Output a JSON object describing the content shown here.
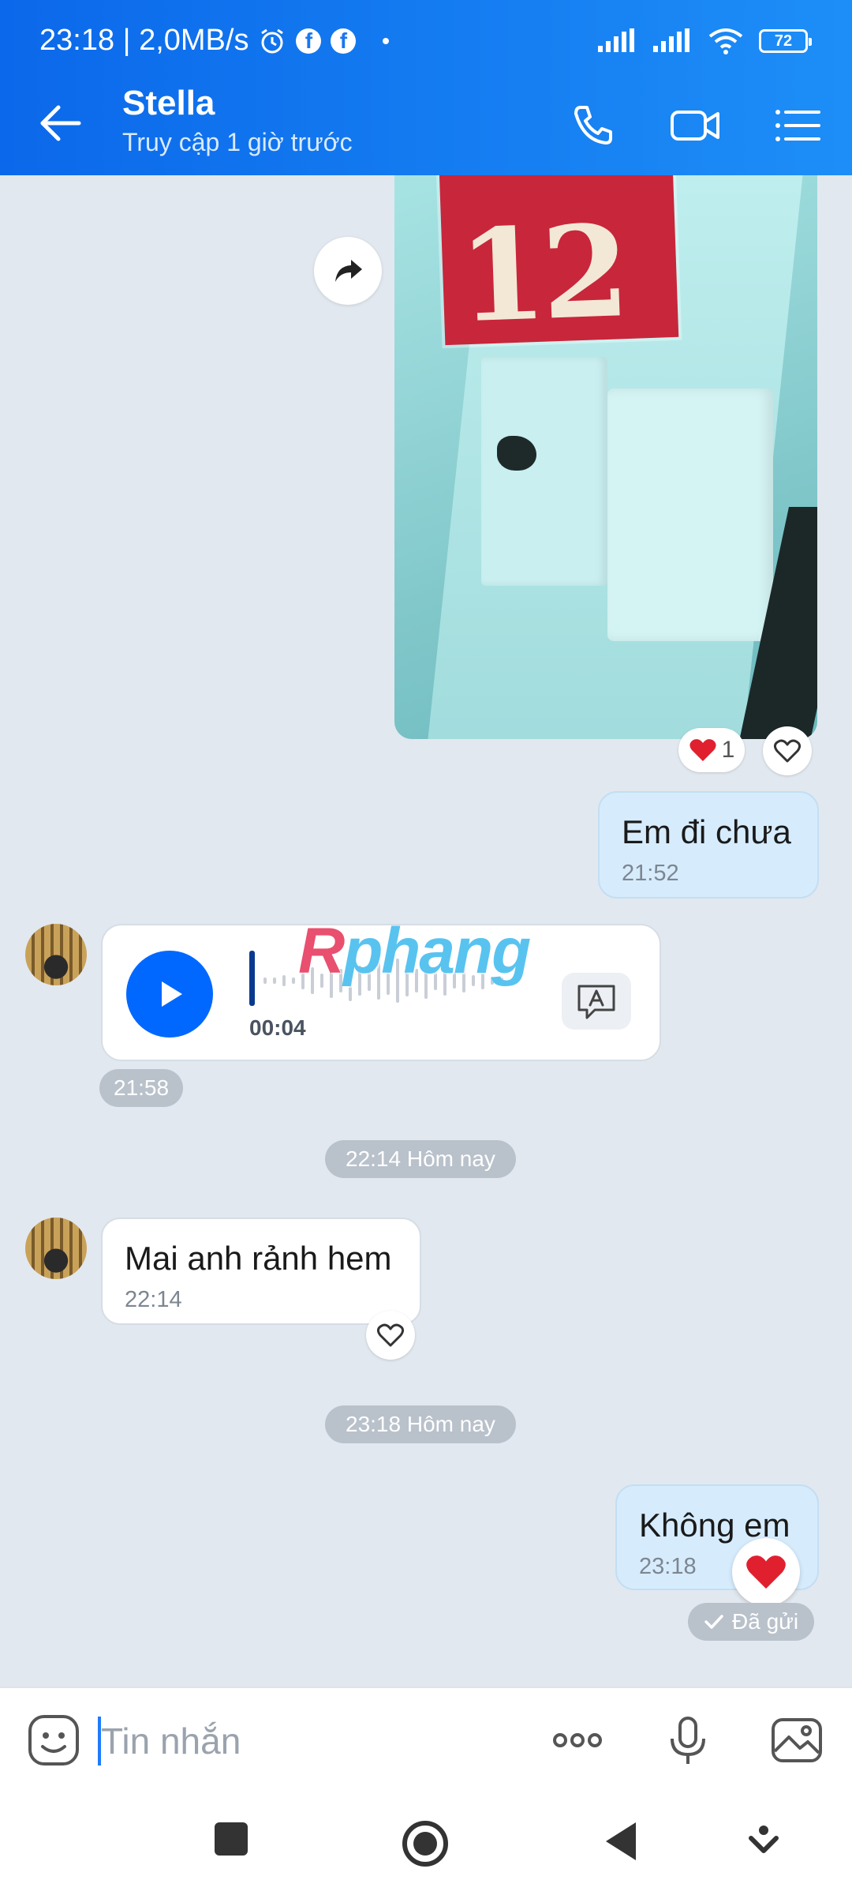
{
  "status_bar": {
    "time_speed": "23:18 | 2,0MB/s",
    "fb1": "f",
    "fb2": "f",
    "battery": "72"
  },
  "header": {
    "contact_name": "Stella",
    "last_seen": "Truy cập 1 giờ trước"
  },
  "photo_message": {
    "plate_text": "12",
    "reaction_count": "1"
  },
  "messages": [
    {
      "direction": "out",
      "text": "Em đi chưa",
      "time": "21:52"
    },
    {
      "direction": "in",
      "type": "voice",
      "duration": "00:04",
      "time": "21:58"
    },
    {
      "direction": "in",
      "text": "Mai anh rảnh hem",
      "time": "22:14"
    },
    {
      "direction": "out",
      "text": "Không em",
      "time": "23:18",
      "status": "Đã gửi"
    }
  ],
  "separators": [
    "22:14 Hôm nay",
    "23:18 Hôm nay"
  ],
  "watermark": {
    "a": "R",
    "b": "phang"
  },
  "input": {
    "placeholder": "Tin nhắn"
  },
  "colors": {
    "brand_blue": "#0068ff",
    "header_gradient_start": "#0b68ea",
    "outgoing_bubble": "#d6ecfd"
  }
}
